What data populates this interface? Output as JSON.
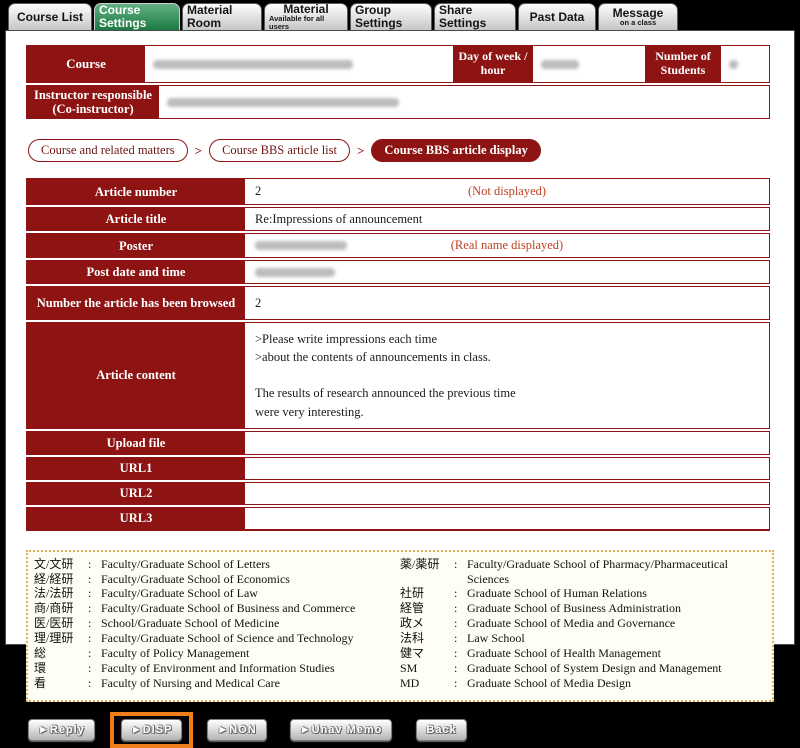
{
  "colors": {
    "accent_red": "#8e1414",
    "tab_active_green": "#1d7a44",
    "note_red": "#c04020",
    "highlight_orange": "#ee7d1b",
    "legend_border_tan": "#dcae5e"
  },
  "tabs": [
    {
      "label": "Course List"
    },
    {
      "label": "Course Settings",
      "active": true
    },
    {
      "label": "Material Room"
    },
    {
      "label": "Material",
      "sub": "Available for all users"
    },
    {
      "label": "Group Settings"
    },
    {
      "label": "Share Settings"
    },
    {
      "label": "Past Data"
    },
    {
      "label": "Message",
      "sub": "on a class"
    }
  ],
  "course_header": {
    "course_label": "Course",
    "day_label": "Day of week / hour",
    "students_label": "Number of Students",
    "instructor_label": "Instructor responsible (Co-instructor)"
  },
  "breadcrumb": {
    "separator": ">",
    "items": [
      {
        "label": "Course and related matters"
      },
      {
        "label": "Course BBS article list"
      },
      {
        "label": "Course BBS article display",
        "active": true
      }
    ]
  },
  "article": {
    "rows": [
      {
        "label": "Article number",
        "value": "2",
        "note": "(Not displayed)"
      },
      {
        "label": "Article title",
        "value": "Re:Impressions of announcement"
      },
      {
        "label": "Poster",
        "note": "(Real name displayed)"
      },
      {
        "label": "Post date and time"
      },
      {
        "label": "Number the article has been browsed",
        "value": "2"
      },
      {
        "label": "Article content",
        "value": ">Please write impressions each time\n>about the contents of announcements in class.\n\nThe results of research announced the previous time\nwere very interesting."
      },
      {
        "label": "Upload file",
        "value": ""
      },
      {
        "label": "URL1",
        "value": ""
      },
      {
        "label": "URL2",
        "value": ""
      },
      {
        "label": "URL3",
        "value": ""
      }
    ]
  },
  "legend": {
    "sep": ":",
    "left": [
      {
        "abbr": "文/文研",
        "name": "Faculty/Graduate School of Letters"
      },
      {
        "abbr": "経/経研",
        "name": "Faculty/Graduate School of Economics"
      },
      {
        "abbr": "法/法研",
        "name": "Faculty/Graduate School of Law"
      },
      {
        "abbr": "商/商研",
        "name": "Faculty/Graduate School of Business and Commerce"
      },
      {
        "abbr": "医/医研",
        "name": "School/Graduate School of Medicine"
      },
      {
        "abbr": "理/理研",
        "name": "Faculty/Graduate School of Science and Technology"
      },
      {
        "abbr": "総",
        "name": "Faculty of Policy Management"
      },
      {
        "abbr": "環",
        "name": "Faculty of Environment and Information Studies"
      },
      {
        "abbr": "看",
        "name": "Faculty of Nursing and Medical Care"
      }
    ],
    "right": [
      {
        "abbr": "薬/薬研",
        "name": "Faculty/Graduate School of Pharmacy/Pharmaceutical Sciences"
      },
      {
        "abbr": "社研",
        "name": "Graduate School of Human Relations"
      },
      {
        "abbr": "経管",
        "name": "Graduate School of Business Administration"
      },
      {
        "abbr": "政メ",
        "name": "Graduate School of Media and Governance"
      },
      {
        "abbr": "法科",
        "name": "Law School"
      },
      {
        "abbr": "健マ",
        "name": "Graduate School of Health Management"
      },
      {
        "abbr": "SM",
        "name": "Graduate School of System Design and Management"
      },
      {
        "abbr": "MD",
        "name": "Graduate School of Media Design"
      }
    ]
  },
  "buttons": {
    "reply": "►Reply",
    "disp": "►DISP",
    "non": "►NON",
    "unav_memo": "►Unav Memo",
    "back": "Back"
  }
}
